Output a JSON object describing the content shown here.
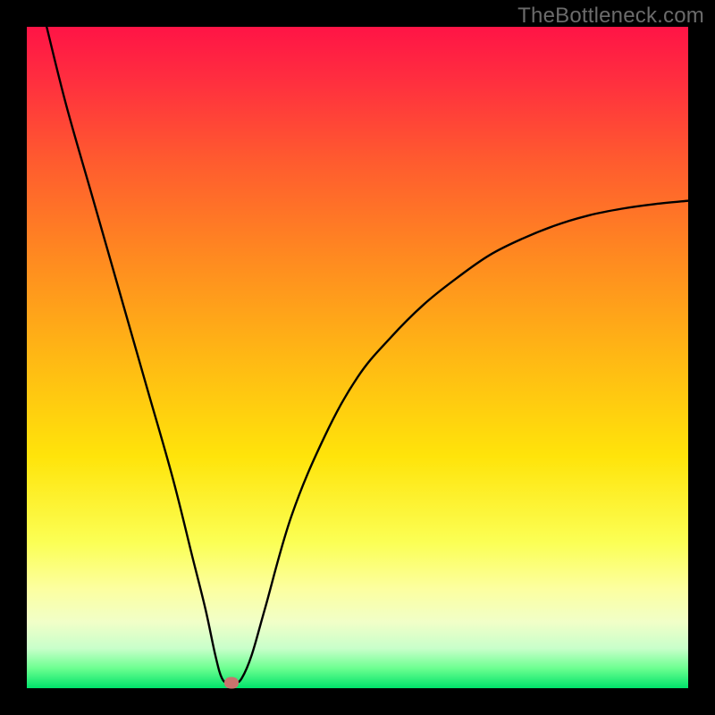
{
  "watermark": "TheBottleneck.com",
  "chart_data": {
    "type": "line",
    "title": "",
    "xlabel": "",
    "ylabel": "",
    "xlim": [
      0,
      100
    ],
    "ylim": [
      0,
      100
    ],
    "series": [
      {
        "name": "curve",
        "x": [
          3,
          6,
          10,
          14,
          18,
          22,
          25,
          27,
          28.5,
          29.5,
          30.5,
          31.5,
          32.5,
          34,
          36,
          40,
          45,
          50,
          55,
          60,
          65,
          70,
          75,
          80,
          85,
          90,
          95,
          100
        ],
        "y": [
          100,
          88,
          74,
          60,
          46,
          32,
          20,
          12,
          5,
          1.5,
          0.8,
          0.8,
          1.5,
          5,
          12,
          26,
          38,
          47,
          53,
          58,
          62,
          65.5,
          68,
          70,
          71.5,
          72.5,
          73.2,
          73.7
        ]
      }
    ],
    "marker": {
      "x": 31,
      "y": 0.8
    },
    "gradient": {
      "top": "#ff1446",
      "bottom": "#00e26a"
    }
  }
}
